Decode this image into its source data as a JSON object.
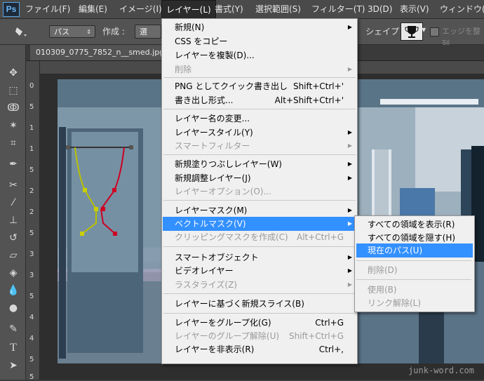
{
  "app": {
    "logo": "Ps"
  },
  "menubar": {
    "items": [
      {
        "label": "ファイル(F)"
      },
      {
        "label": "編集(E)"
      },
      {
        "label": "イメージ(I)"
      },
      {
        "label": "レイヤー(L)"
      },
      {
        "label": "書式(Y)"
      },
      {
        "label": "選択範囲(S)"
      },
      {
        "label": "フィルター(T)"
      },
      {
        "label": "3D(D)"
      },
      {
        "label": "表示(V)"
      },
      {
        "label": "ウィンドウ(W)"
      }
    ]
  },
  "options": {
    "mode_value": "パス",
    "create_label": "作成 :",
    "select_button": "選択...",
    "shape_label": "シェイプ :",
    "edge_label": "エッジを整列"
  },
  "document": {
    "tab_title": "010309_0775_7852_n__smed.jpg"
  },
  "rulers": {
    "left_numbers": [
      "0",
      "5",
      "1",
      "1",
      "5",
      "2",
      "2",
      "5",
      "3",
      "3",
      "5",
      "4",
      "4",
      "5",
      "5"
    ]
  },
  "watermark": "junk-word.com",
  "layer_menu": {
    "items": [
      {
        "type": "item",
        "label": "新規(N)",
        "submenu": true
      },
      {
        "type": "item",
        "label": "CSS をコピー"
      },
      {
        "type": "item",
        "label": "レイヤーを複製(D)..."
      },
      {
        "type": "item",
        "label": "削除",
        "disabled": true,
        "submenu": true
      },
      {
        "type": "sep"
      },
      {
        "type": "item",
        "label": "PNG としてクイック書き出し",
        "shortcut": "Shift+Ctrl+'"
      },
      {
        "type": "item",
        "label": "書き出し形式...",
        "shortcut": "Alt+Shift+Ctrl+'"
      },
      {
        "type": "sep"
      },
      {
        "type": "item",
        "label": "レイヤー名の変更..."
      },
      {
        "type": "item",
        "label": "レイヤースタイル(Y)",
        "submenu": true
      },
      {
        "type": "item",
        "label": "スマートフィルター",
        "disabled": true,
        "submenu": true
      },
      {
        "type": "sep"
      },
      {
        "type": "item",
        "label": "新規塗りつぶしレイヤー(W)",
        "submenu": true
      },
      {
        "type": "item",
        "label": "新規調整レイヤー(J)",
        "submenu": true
      },
      {
        "type": "item",
        "label": "レイヤーオプション(O)...",
        "disabled": true
      },
      {
        "type": "sep"
      },
      {
        "type": "item",
        "label": "レイヤーマスク(M)",
        "submenu": true
      },
      {
        "type": "item",
        "label": "ベクトルマスク(V)",
        "submenu": true,
        "highlight": true
      },
      {
        "type": "item",
        "label": "クリッピングマスクを作成(C)",
        "shortcut": "Alt+Ctrl+G",
        "disabled": true
      },
      {
        "type": "sep"
      },
      {
        "type": "item",
        "label": "スマートオブジェクト",
        "submenu": true
      },
      {
        "type": "item",
        "label": "ビデオレイヤー",
        "submenu": true
      },
      {
        "type": "item",
        "label": "ラスタライズ(Z)",
        "disabled": true,
        "submenu": true
      },
      {
        "type": "sep"
      },
      {
        "type": "item",
        "label": "レイヤーに基づく新規スライス(B)"
      },
      {
        "type": "sep"
      },
      {
        "type": "item",
        "label": "レイヤーをグループ化(G)",
        "shortcut": "Ctrl+G"
      },
      {
        "type": "item",
        "label": "レイヤーのグループ解除(U)",
        "shortcut": "Shift+Ctrl+G",
        "disabled": true
      },
      {
        "type": "item",
        "label": "レイヤーを非表示(R)",
        "shortcut": "Ctrl+,"
      }
    ]
  },
  "vector_mask_submenu": {
    "items": [
      {
        "type": "item",
        "label": "すべての領域を表示(R)"
      },
      {
        "type": "item",
        "label": "すべての領域を隠す(H)"
      },
      {
        "type": "item",
        "label": "現在のパス(U)",
        "highlight": true
      },
      {
        "type": "sep"
      },
      {
        "type": "item",
        "label": "削除(D)",
        "disabled": true
      },
      {
        "type": "sep"
      },
      {
        "type": "item",
        "label": "使用(B)",
        "disabled": true
      },
      {
        "type": "item",
        "label": "リンク解除(L)",
        "disabled": true
      }
    ]
  },
  "colors": {
    "highlight": "#3390ff",
    "menu_bg": "#f0f0f0",
    "ui_dark": "#535353"
  }
}
